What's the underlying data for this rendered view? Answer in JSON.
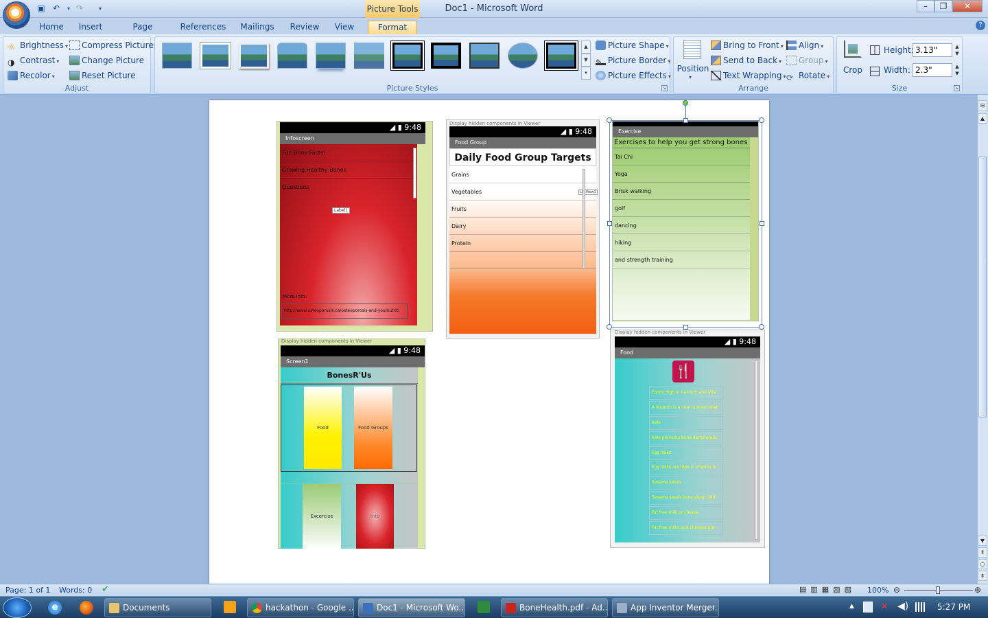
{
  "window": {
    "title": "Doc1 - Microsoft Word",
    "contextual_tab": "Picture Tools"
  },
  "tabs": [
    "Home",
    "Insert",
    "Page Layout",
    "References",
    "Mailings",
    "Review",
    "View",
    "Format"
  ],
  "active_tab": "Format",
  "adjust": {
    "label": "Adjust",
    "brightness": "Brightness",
    "contrast": "Contrast",
    "recolor": "Recolor",
    "compress": "Compress Pictures",
    "change": "Change Picture",
    "reset": "Reset Picture"
  },
  "styles": {
    "label": "Picture Styles",
    "shape": "Picture Shape",
    "border": "Picture Border",
    "effects": "Picture Effects"
  },
  "arrange": {
    "label": "Arrange",
    "position": "Position",
    "front": "Bring to Front",
    "back": "Send to Back",
    "wrap": "Text Wrapping",
    "align": "Align",
    "group": "Group",
    "rotate": "Rotate"
  },
  "size": {
    "label": "Size",
    "crop": "Crop",
    "height_label": "Height:",
    "height": "3.13\"",
    "width_label": "Width:",
    "width": "2.3\""
  },
  "screens": {
    "infoscreen": {
      "time": "9:48",
      "title": "Infoscreen",
      "items": [
        "Fun Bone Facts!",
        "Growing Healthy Bones",
        "Questions"
      ],
      "label": "Label1",
      "more": "More Info:",
      "url": "http://www.osteoporosis.ca/osteoporosis-and-you/nutriti"
    },
    "foodgroup": {
      "hint": "Display hidden components in Viewer",
      "time": "9:48",
      "title": "Food Group",
      "heading": "Daily Food Group Targets",
      "items": [
        "Grains",
        "Vegetables",
        "Fruits",
        "Dairy",
        "Protein"
      ],
      "listview": "ListView1"
    },
    "exercise": {
      "title": "Exercise",
      "heading": "Exercises to help you get strong bones",
      "items": [
        "Tai Chi",
        "Yoga",
        "Brisk walking",
        "golf",
        "dancing",
        "hiking",
        "and strength training"
      ]
    },
    "screen1": {
      "hint": "Display hidden components in Viewer",
      "time": "9:48",
      "title": "Screen1",
      "heading": "BonesR'Us",
      "buttons": [
        "Food",
        "Food Groups",
        "Excercise",
        "Info"
      ]
    },
    "food": {
      "hint": "Display hidden components in Viewer",
      "time": "9:48",
      "title": "Food",
      "items": [
        "Foods High in Calcium and Vita",
        "A Vitamin is a vital nutrient that",
        "Kale",
        "Kale prevents bone demineraliz",
        "Egg Yolks",
        "Egg Yolks are high in vitamin D",
        "Sesame seeds",
        "Sesame seeds have about 990",
        "Fat free milk or cheese",
        "Fat free milks and cheeses are"
      ]
    }
  },
  "status": {
    "page": "Page: 1 of 1",
    "words": "Words: 0",
    "zoom": "100%"
  },
  "taskbar": {
    "items": [
      "Documents",
      "hackathon - Google ...",
      "Doc1 - Microsoft Wo...",
      "BoneHealth.pdf - Ad...",
      "App Inventor Merger..."
    ],
    "time": "5:27 PM"
  }
}
